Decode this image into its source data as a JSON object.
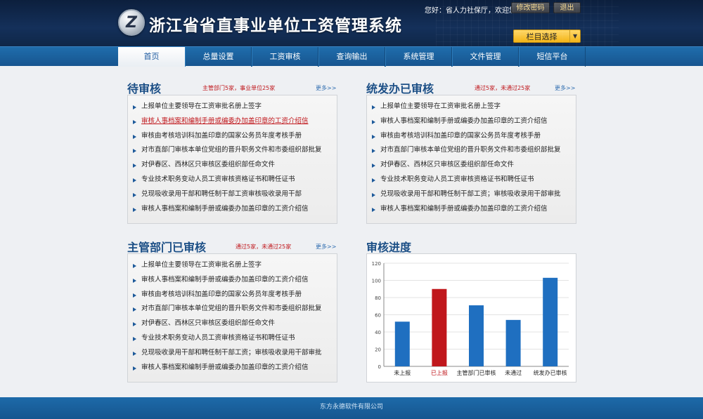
{
  "header": {
    "system_title": "浙江省省直事业单位工资管理系统",
    "logo_letter": "Z",
    "greeting": "您好：省人力社保厅，欢迎您！",
    "change_password_label": "修改密码",
    "logout_label": "退出",
    "column_select_label": "栏目选择"
  },
  "nav": {
    "items": [
      {
        "label": "首页",
        "active": true
      },
      {
        "label": "总量设置"
      },
      {
        "label": "工资审核"
      },
      {
        "label": "查询输出"
      },
      {
        "label": "系统管理"
      },
      {
        "label": "文件管理"
      },
      {
        "label": "短信平台"
      }
    ]
  },
  "panels": {
    "pending": {
      "title": "待审核",
      "summary": "主管部门5家，事业单位25家",
      "more": "更多>>",
      "items": [
        "上报单位主要领导在工资审批名册上签字",
        "审核人事档案和编制手册或编委办加盖印章的工资介绍信",
        "审核由考核培训科加盖印章的国家公务员年度考核手册",
        "对市直部门审核本单位党组的晋升职务文件和市委组织部批复",
        "对伊春区、西林区只审核区委组织部任命文件",
        "专业技术职务变动人员工资审核资格证书和聘任证书",
        "兑现吸收录用干部和聘任制干部工资审核吸收录用干部",
        "审核人事档案和编制手册或编委办加盖印章的工资介绍信"
      ]
    },
    "office": {
      "title": "统发办已审核",
      "summary": "通过5家，未通过25家",
      "more": "更多>>",
      "items": [
        "上报单位主要领导在工资审批名册上签字",
        "审核人事档案和编制手册或编委办加盖印章的工资介绍信",
        "审核由考核培训科加盖印章的国家公务员年度考核手册",
        "对市直部门审核本单位党组的晋升职务文件和市委组织部批复",
        "对伊春区、西林区只审核区委组织部任命文件",
        "专业技术职务变动人员工资审核资格证书和聘任证书",
        "兑现吸收录用干部和聘任制干部工资；审核吸收录用干部审批",
        "审核人事档案和编制手册或编委办加盖印章的工资介绍信"
      ]
    },
    "dept": {
      "title": "主管部门已审核",
      "summary": "通过5家，未通过25家",
      "more": "更多>>",
      "items": [
        "上报单位主要领导在工资审批名册上签字",
        "审核人事档案和编制手册或编委办加盖印章的工资介绍信",
        "审核由考核培训科加盖印章的国家公务员年度考核手册",
        "对市直部门审核本单位党组的晋升职务文件和市委组织部批复",
        "对伊春区、西林区只审核区委组织部任命文件",
        "专业技术职务变动人员工资审核资格证书和聘任证书",
        "兑现吸收录用干部和聘任制干部工资；审核吸收录用干部审批",
        "审核人事档案和编制手册或编委办加盖印章的工资介绍信"
      ]
    },
    "progress": {
      "title": "审核进度"
    }
  },
  "chart_data": {
    "type": "bar",
    "title": "",
    "categories": [
      "未上报",
      "已上报",
      "主管部门已审核",
      "未通过",
      "统发办已审核"
    ],
    "values": [
      52,
      90,
      71,
      54,
      103
    ],
    "colors": [
      "#1f6fc0",
      "#c0171c",
      "#1f6fc0",
      "#1f6fc0",
      "#1f6fc0"
    ],
    "label_colors": [
      "#222222",
      "#c0171c",
      "#222222",
      "#222222",
      "#222222"
    ],
    "ylim": [
      0,
      120
    ],
    "yticks": [
      0,
      20,
      40,
      60,
      80,
      100,
      120
    ],
    "grid": true
  },
  "footer": {
    "company": "东方永德软件有限公司"
  }
}
